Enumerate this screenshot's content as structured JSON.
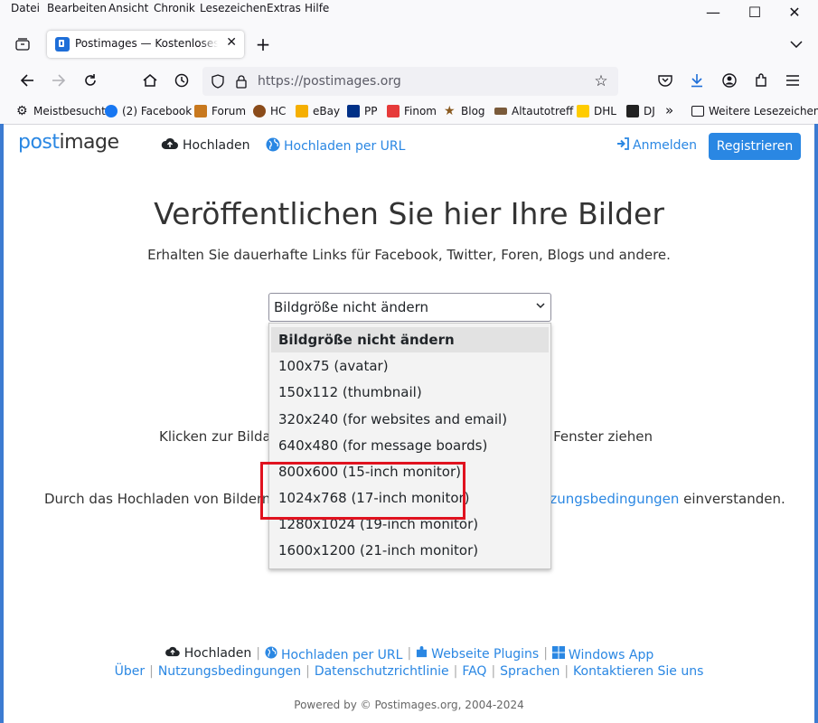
{
  "menubar": {
    "items": [
      "Datei",
      "Bearbeiten",
      "Ansicht",
      "Chronik",
      "Lesezeichen",
      "Extras",
      "Hilfe"
    ]
  },
  "window_controls": {
    "minimize": "—",
    "maximize": "☐",
    "close": "✕"
  },
  "tab": {
    "title": "Postimages — Kostenloses Bildhosting"
  },
  "urlbar": {
    "url": "https://postimages.org"
  },
  "bookmarks": [
    "Meistbesucht",
    "(2) Facebook",
    "Forum",
    "HC",
    "eBay",
    "PP",
    "Finom",
    "Blog",
    "Altautotreff",
    "DHL",
    "DJ",
    "»",
    "Weitere Lesezeichen"
  ],
  "site": {
    "logo_a": "post",
    "logo_b": "image",
    "nav_upload": "Hochladen",
    "nav_upload_url": "Hochladen per URL",
    "login": "Anmelden",
    "register": "Registrieren"
  },
  "main": {
    "title": "Veröffentlichen Sie hier Ihre Bilder",
    "subtitle": "Erhalten Sie dauerhafte Links für Facebook, Twitter, Foren, Blogs und andere.",
    "select_value": "Bildgröße nicht ändern",
    "drop_left": "Klicken zur Bildau",
    "drop_right": "ns Fenster ziehen",
    "terms_left": "Durch das Hochladen von Bildern a",
    "terms_link": "utzungsbedingungen",
    "terms_right": " einverstanden."
  },
  "dropdown_options": [
    "Bildgröße nicht ändern",
    "100x75 (avatar)",
    "150x112 (thumbnail)",
    "320x240 (for websites and email)",
    "640x480 (for message boards)",
    "800x600 (15-inch monitor)",
    "1024x768 (17-inch monitor)",
    "1280x1024 (19-inch monitor)",
    "1600x1200 (21-inch monitor)"
  ],
  "footer": {
    "row1": [
      "Hochladen",
      "Hochladen per URL",
      "Webseite Plugins",
      "Windows App"
    ],
    "row2": [
      "Über",
      "Nutzungsbedingungen",
      "Datenschutzrichtlinie",
      "FAQ",
      "Sprachen",
      "Kontaktieren Sie uns"
    ],
    "powered": "Powered by © Postimages.org, 2004-2024"
  },
  "colors": {
    "accent": "#2a87e3",
    "highlight": "#e0121f"
  }
}
